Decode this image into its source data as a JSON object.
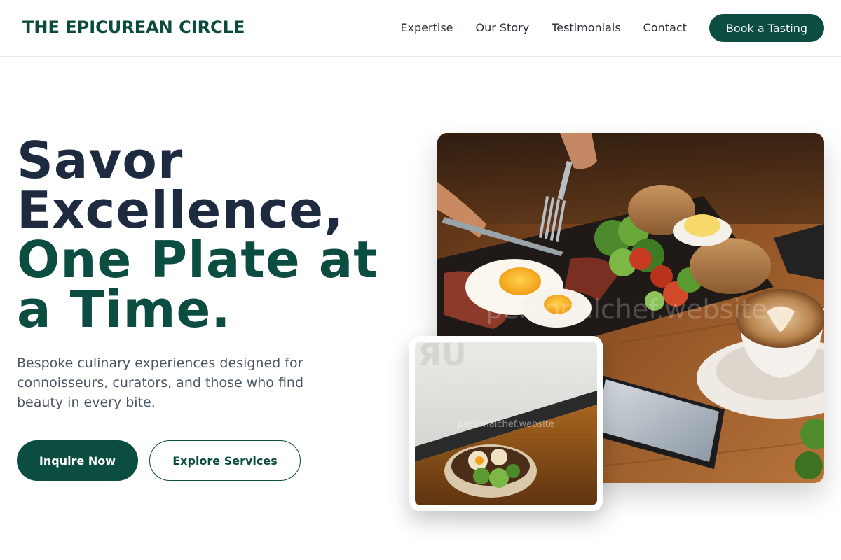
{
  "brand": {
    "name": "THE EPICUREAN CIRCLE"
  },
  "nav": {
    "links": [
      "Expertise",
      "Our Story",
      "Testimonials",
      "Contact"
    ],
    "cta": "Book a Tasting"
  },
  "hero": {
    "title_line1": "Savor",
    "title_line2": "Excellence,",
    "title_line3": "One Plate at",
    "title_line4": "a Time.",
    "subtitle": "Bespoke culinary experiences designed for connoisseurs, curators, and those who find beauty in every bite.",
    "primary_cta": "Inquire Now",
    "secondary_cta": "Explore Services"
  },
  "images": {
    "main_watermark": "personalchef.website",
    "inset_watermark": "personalchef.website"
  },
  "colors": {
    "brand_green": "#0b4d40",
    "heading_dark": "#1e2a3f",
    "body_gray": "#4b5563"
  }
}
